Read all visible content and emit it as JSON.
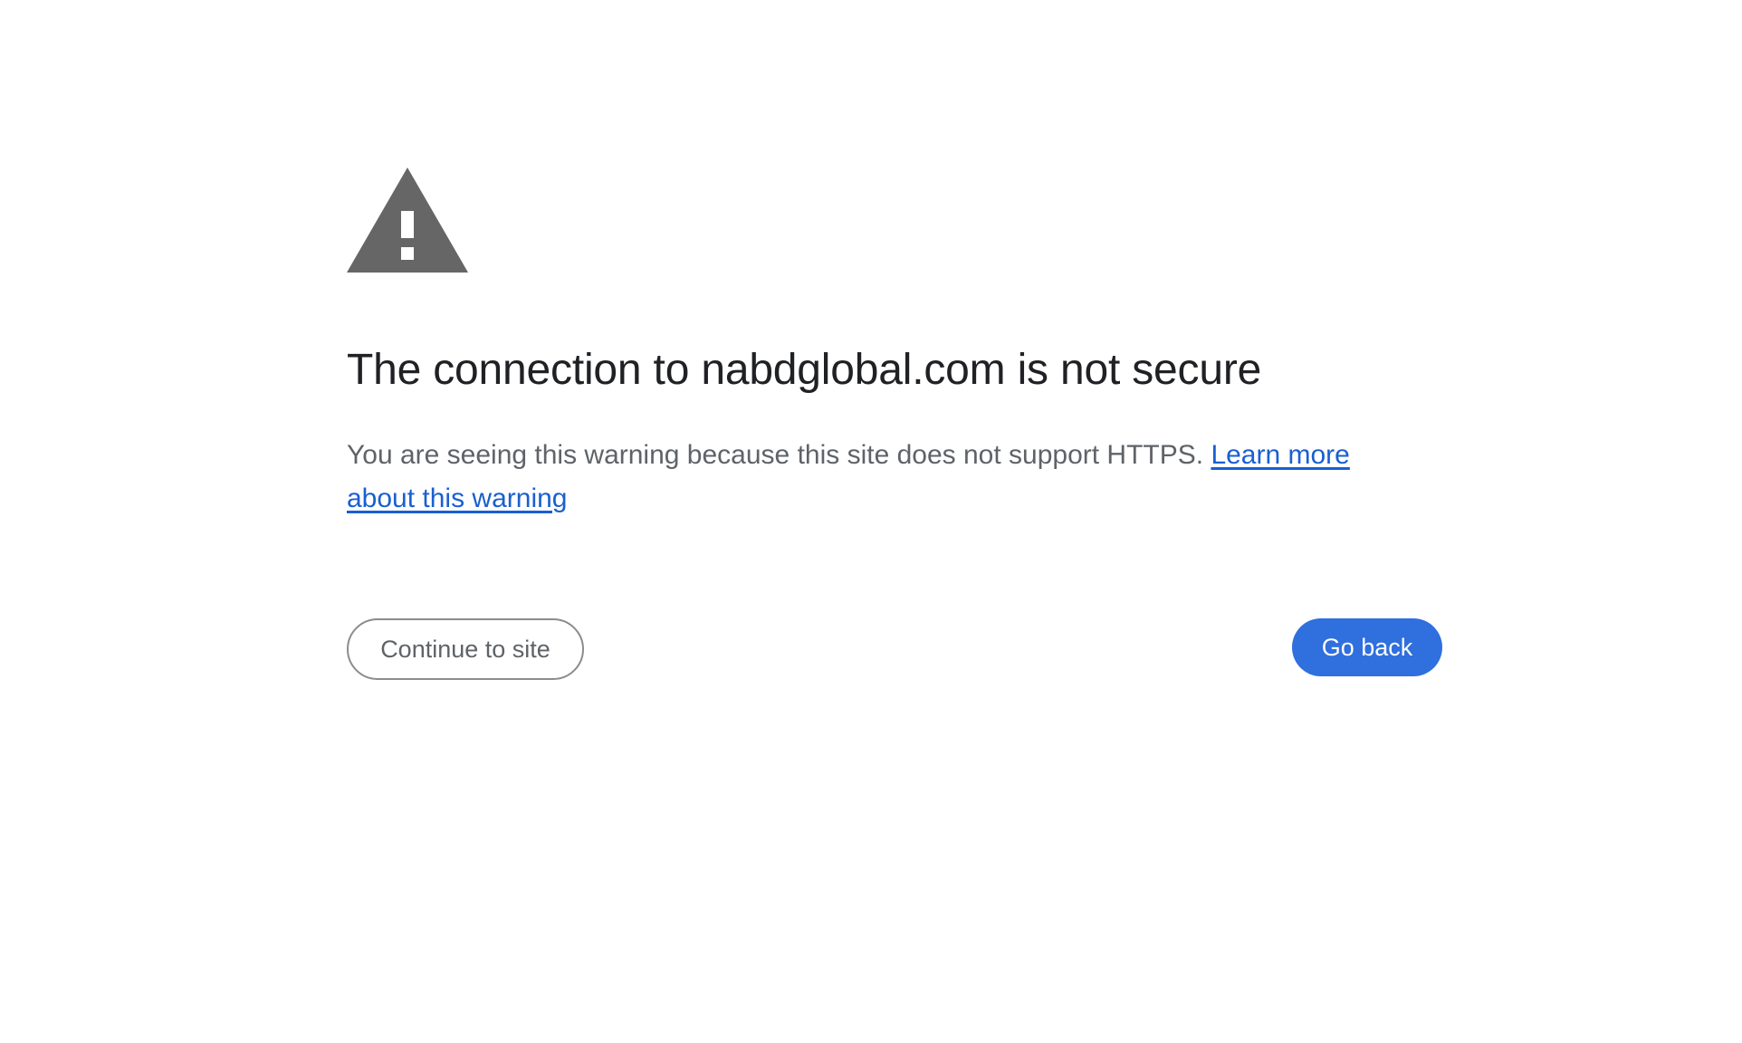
{
  "icons": {
    "warning": "warning-triangle-icon"
  },
  "colors": {
    "icon": "#666666",
    "title": "#202124",
    "body_text": "#5f6368",
    "link": "#1a5fd0",
    "primary_button": "#2f6fde"
  },
  "interstitial": {
    "title": "The connection to nabdglobal.com is not secure",
    "description": "You are seeing this warning because this site does not support HTTPS. ",
    "learn_more_link": "Learn more about this warning"
  },
  "buttons": {
    "continue_label": "Continue to site",
    "go_back_label": "Go back"
  }
}
